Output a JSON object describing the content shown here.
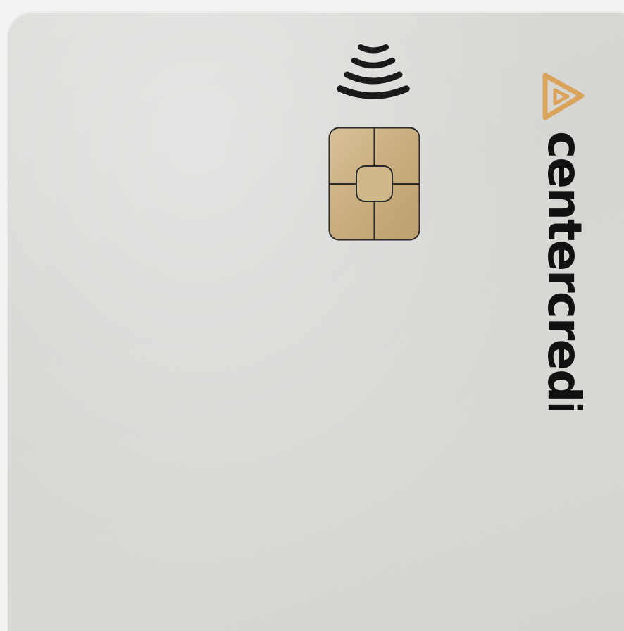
{
  "card": {
    "brand_name": "centercredit",
    "colors": {
      "card_surface": "#d8d8d5",
      "chip_gold": "#cdb48a",
      "logo_orange": "#d9a35c",
      "ink": "#111111"
    },
    "icons": [
      "contactless-icon",
      "emv-chip",
      "centercredit-logo-icon"
    ]
  }
}
